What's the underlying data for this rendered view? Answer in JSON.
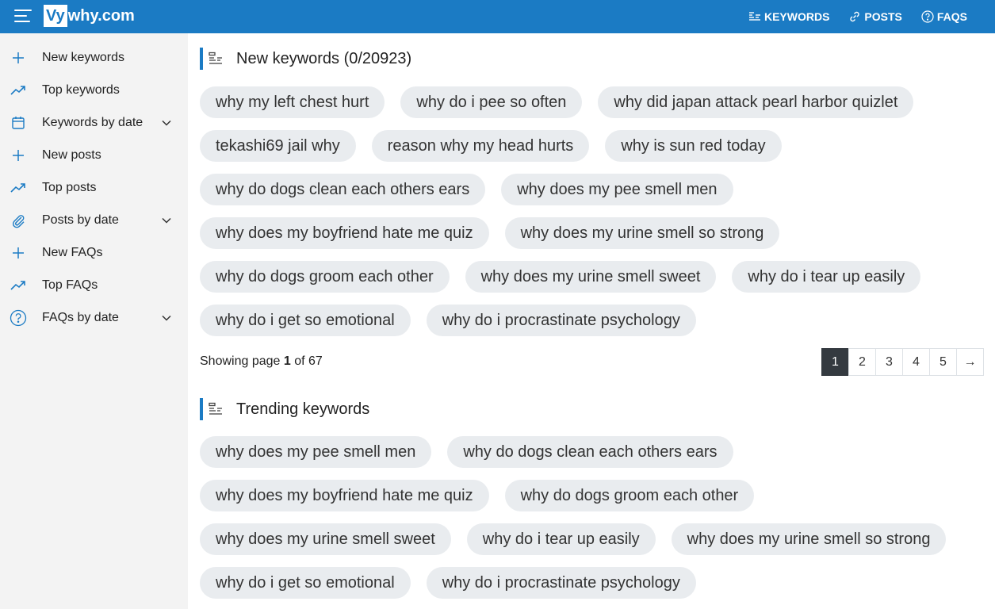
{
  "header": {
    "logo_badge": "Vy",
    "logo_text": "why.com",
    "nav": [
      {
        "label": "KEYWORDS",
        "icon": "list-icon"
      },
      {
        "label": "POSTS",
        "icon": "link-icon"
      },
      {
        "label": "FAQS",
        "icon": "question-circle-icon"
      }
    ]
  },
  "sidebar": {
    "items": [
      {
        "label": "New keywords",
        "icon": "plus-icon"
      },
      {
        "label": "Top keywords",
        "icon": "trending-icon"
      },
      {
        "label": "Keywords by date",
        "icon": "calendar-icon",
        "expandable": true
      },
      {
        "label": "New posts",
        "icon": "plus-icon"
      },
      {
        "label": "Top posts",
        "icon": "trending-icon"
      },
      {
        "label": "Posts by date",
        "icon": "link-icon",
        "expandable": true
      },
      {
        "label": "New FAQs",
        "icon": "plus-icon"
      },
      {
        "label": "Top FAQs",
        "icon": "trending-icon"
      },
      {
        "label": "FAQs by date",
        "icon": "question-circle-icon",
        "expandable": true
      }
    ]
  },
  "new_keywords": {
    "title": "New keywords (0/20923)",
    "chips": [
      "why my left chest hurt",
      "why do i pee so often",
      "why did japan attack pearl harbor quizlet",
      "tekashi69 jail why",
      "reason why my head hurts",
      "why is sun red today",
      "why do dogs clean each others ears",
      "why does my pee smell men",
      "why does my boyfriend hate me quiz",
      "why does my urine smell so strong",
      "why do dogs groom each other",
      "why does my urine smell sweet",
      "why do i tear up easily",
      "why do i get so emotional",
      "why do i procrastinate psychology"
    ],
    "showing_prefix": "Showing page",
    "current_page": "1",
    "showing_of": "of 67",
    "pages": [
      "1",
      "2",
      "3",
      "4",
      "5",
      "→"
    ]
  },
  "trending_keywords": {
    "title": "Trending keywords",
    "chips": [
      "why does my pee smell men",
      "why do dogs clean each others ears",
      "why does my boyfriend hate me quiz",
      "why do dogs groom each other",
      "why does my urine smell sweet",
      "why do i tear up easily",
      "why does my urine smell so strong",
      "why do i get so emotional",
      "why do i procrastinate psychology"
    ]
  },
  "colors": {
    "brand": "#1b7bc4",
    "chip_bg": "#e9ecef",
    "pager_active": "#343a40",
    "sidebar_bg": "#f3f3f3"
  }
}
